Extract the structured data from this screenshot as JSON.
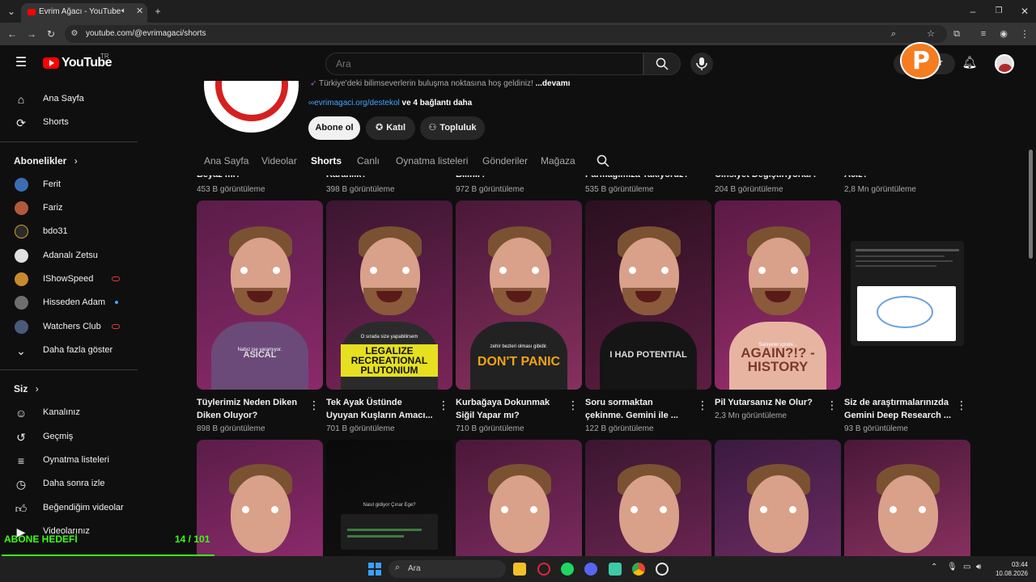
{
  "browser": {
    "tab_title": "Evrim Ağacı - YouTube",
    "url": "youtube.com/@evrimagaci/shorts"
  },
  "header": {
    "logo_text": "YouTube",
    "country_code": "TR",
    "search_placeholder": "Ara",
    "partial_button_text": "ar"
  },
  "sidebar": {
    "main": [
      {
        "label": "Ana Sayfa",
        "icon": "home-icon"
      },
      {
        "label": "Shorts",
        "icon": "shorts-icon"
      }
    ],
    "subscriptions_title": "Abonelikler",
    "subscriptions": [
      {
        "label": "Ferit",
        "color": "#3b6db3",
        "badge": ""
      },
      {
        "label": "Fariz",
        "color": "#b05a3a",
        "badge": ""
      },
      {
        "label": "bdo31",
        "color": "#2a2a2a",
        "badge": ""
      },
      {
        "label": "Adanalı Zetsu",
        "color": "#e0e0e0",
        "badge": ""
      },
      {
        "label": "IShowSpeed",
        "color": "#c98a2e",
        "badge": "live"
      },
      {
        "label": "Hisseden Adam",
        "color": "#6e6e6e",
        "badge": "new"
      },
      {
        "label": "Watchers Club",
        "color": "#4a5a7a",
        "badge": "live"
      }
    ],
    "show_more": "Daha fazla göster",
    "you_title": "Siz",
    "you_items": [
      {
        "label": "Kanalınız",
        "icon": "channel-icon"
      },
      {
        "label": "Geçmiş",
        "icon": "history-icon"
      },
      {
        "label": "Oynatma listeleri",
        "icon": "playlists-icon"
      },
      {
        "label": "Daha sonra izle",
        "icon": "watch-later-icon"
      },
      {
        "label": "Beğendiğim videolar",
        "icon": "like-icon"
      },
      {
        "label": "Videolarınız",
        "icon": "your-videos-icon"
      }
    ]
  },
  "channel": {
    "description": "Türkiye'deki bilimseverlerin buluşma noktasına hoş geldiniz!",
    "more_label": "...devamı",
    "link": "evrimagaci.org/destekol",
    "other_links": "ve 4 bağlantı daha",
    "subscribe_label": "Abone ol",
    "join_label": "Katıl",
    "community_label": "Topluluk"
  },
  "tabs": [
    "Ana Sayfa",
    "Videolar",
    "Shorts",
    "Canlı",
    "Oynatma listeleri",
    "Gönderiler",
    "Mağaza"
  ],
  "previous_row": [
    {
      "title": "Beyaz mı?",
      "views": "453 B görüntüleme"
    },
    {
      "title": "Karanlık?",
      "views": "398 B görüntüleme"
    },
    {
      "title": "Bilinir?",
      "views": "972 B görüntüleme"
    },
    {
      "title": "Parmağımıza Takıyoruz?",
      "views": "535 B görüntüleme"
    },
    {
      "title": "Cinsiyet Değiştiriyorlar?",
      "views": "204 B görüntüleme"
    },
    {
      "title": "Aciz?",
      "views": "2,8 Mn görüntüleme"
    }
  ],
  "shorts": [
    {
      "line1": "Tüylerimiz Neden Diken",
      "line2": "Diken Oluyor?",
      "views": "898 B görüntüleme",
      "caption": "Nabız ise yaramıyor.",
      "tee": "ASICAL",
      "shirt": "#6b4a7a",
      "bg1": "#5a1d48",
      "bg2": "#8a2a6a"
    },
    {
      "line1": "Tek Ayak Üstünde",
      "line2": "Uyuyan Kuşların Amacı...",
      "views": "701 B görüntüleme",
      "caption": "O sırada size yapabilirsem",
      "tee": "LEGALIZE RECREATIONAL PLUTONIUM",
      "shirt": "#2b2b2b",
      "bg1": "#3a1630",
      "bg2": "#7a2458"
    },
    {
      "line1": "Kurbağaya Dokunmak",
      "line2": "Siğil Yapar mı?",
      "views": "710 B görüntüleme",
      "caption": "zehir bezleri olması gibidir.",
      "tee": "DON'T PANIC",
      "shirt": "#222222",
      "bg1": "#4a1838",
      "bg2": "#86305e"
    },
    {
      "line1": "Soru sormaktan",
      "line2": "çekinme. Gemini ile ...",
      "views": "122 B görüntüleme",
      "caption": "",
      "tee": "I HAD POTENTIAL",
      "shirt": "#151515",
      "bg1": "#2a1020",
      "bg2": "#5e1d42"
    },
    {
      "line1": "Pil Yutarsanız Ne Olur?",
      "line2": "",
      "views": "2,3 Mn görüntüleme",
      "caption": "Saniyeler içinde...",
      "tee": "AGAIN?!? -HISTORY",
      "shirt": "#e8b4a2",
      "bg1": "#5a1a44",
      "bg2": "#9a2f6e"
    },
    {
      "line1": "Siz de araştırmalarınızda",
      "line2": "Gemini Deep Research ...",
      "views": "93 B görüntüleme",
      "caption": "",
      "tee": "",
      "shirt": "",
      "bg1": "#0f0f0f",
      "bg2": "#0f0f0f"
    }
  ],
  "next_row_caption": "Nasıl gidiyor Çınar Ege?",
  "overlay": {
    "goal_label": "ABONE HEDEFİ",
    "goal_count": "14 / 101",
    "goal_progress": 0.14
  },
  "taskbar": {
    "search_label": "Ara",
    "time": "03:44",
    "date": "10.08.2026"
  },
  "colors": {
    "accent": "#ff0000",
    "link": "#3ea6ff",
    "overlay_green": "#39ff14"
  }
}
